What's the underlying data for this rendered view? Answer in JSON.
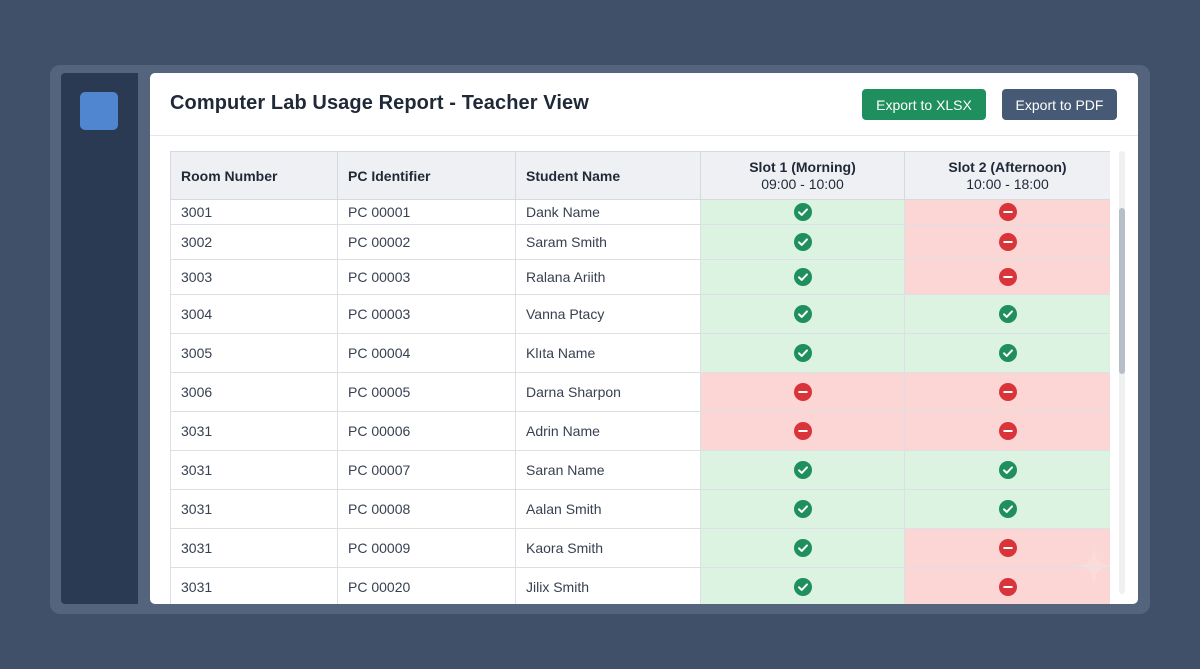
{
  "header": {
    "title": "Computer Lab Usage Report - Teacher View",
    "export_xlsx_label": "Export to XLSX",
    "export_pdf_label": "Export to PDF"
  },
  "table": {
    "columns": [
      {
        "label": "Room Number"
      },
      {
        "label": "PC Identifier"
      },
      {
        "label": "Student Name"
      },
      {
        "label": "Slot 1 (Morning)",
        "time": "09:00 - 10:00"
      },
      {
        "label": "Slot 2 (Afternoon)",
        "time": "10:00 - 18:00"
      }
    ],
    "rows": [
      {
        "room": "3001",
        "pc": "PC 00001",
        "student": "Dank Name",
        "slot1": "available",
        "slot2": "unavailable"
      },
      {
        "room": "3002",
        "pc": "PC 00002",
        "student": "Saram Smith",
        "slot1": "available",
        "slot2": "unavailable"
      },
      {
        "room": "3003",
        "pc": "PC 00003",
        "student": "Ralana Ariith",
        "slot1": "available",
        "slot2": "unavailable"
      },
      {
        "room": "3004",
        "pc": "PC 00003",
        "student": "Vanna Ptacy",
        "slot1": "available",
        "slot2": "available"
      },
      {
        "room": "3005",
        "pc": "PC 00004",
        "student": "Klıta Name",
        "slot1": "available",
        "slot2": "available"
      },
      {
        "room": "3006",
        "pc": "PC 00005",
        "student": "Darna Sharpon",
        "slot1": "unavailable",
        "slot2": "unavailable"
      },
      {
        "room": "3031",
        "pc": "PC 00006",
        "student": "Adrin Name",
        "slot1": "unavailable",
        "slot2": "unavailable"
      },
      {
        "room": "3031",
        "pc": "PC 00007",
        "student": "Saran Name",
        "slot1": "available",
        "slot2": "available"
      },
      {
        "room": "3031",
        "pc": "PC 00008",
        "student": "Aalan Smith",
        "slot1": "available",
        "slot2": "available"
      },
      {
        "room": "3031",
        "pc": "PC 00009",
        "student": "Kaora Smith",
        "slot1": "available",
        "slot2": "unavailable"
      },
      {
        "room": "3031",
        "pc": "PC 00020",
        "student": "Jilix Smith",
        "slot1": "available",
        "slot2": "unavailable"
      }
    ]
  },
  "icons": {
    "available": "check-circle-icon",
    "unavailable": "minus-circle-icon"
  },
  "colors": {
    "available_icon": "#1f8f5d",
    "available_cell": "#dcf3e2",
    "unavailable_icon": "#d9343a",
    "unavailable_cell": "#fcd5d5",
    "export_xlsx": "#1f8f5d",
    "export_pdf": "#475a75",
    "sidebar_logo": "#4f86cf"
  }
}
